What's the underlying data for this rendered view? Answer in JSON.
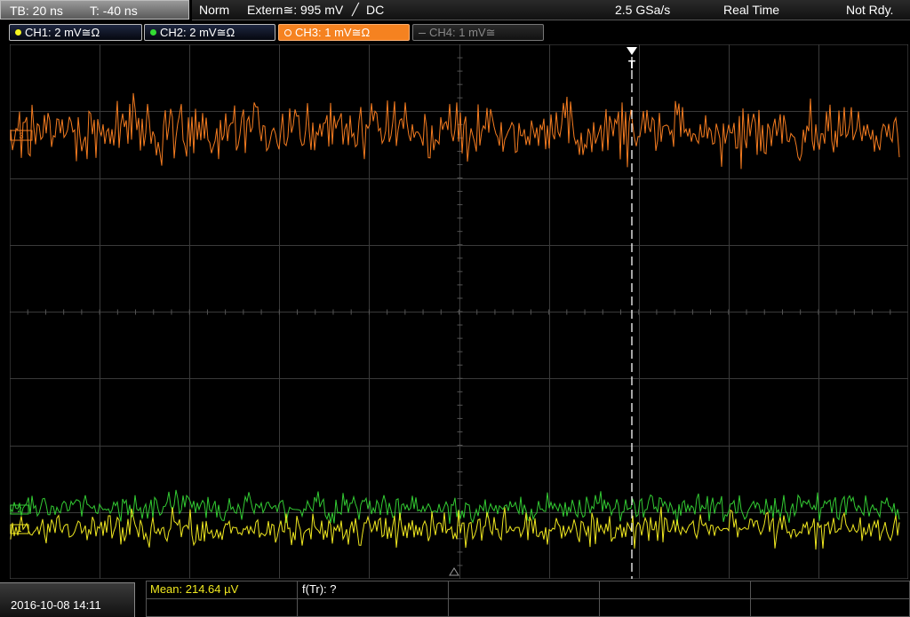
{
  "header": {
    "timebase": "TB: 20 ns",
    "trigger_offset": "T: -40 ns",
    "acq_mode": "Norm",
    "trigger_source": "Extern≅: 995 mV",
    "trigger_slope": "DC",
    "sample_rate": "2.5 GSa/s",
    "realtime": "Real Time",
    "status": "Not Rdy."
  },
  "channels": [
    {
      "label": "CH1: 2 mV≅Ω",
      "color": "#f5f520",
      "state": "on"
    },
    {
      "label": "CH2: 2 mV≅Ω",
      "color": "#33dd33",
      "state": "on"
    },
    {
      "label": "CH3: 1 mV≅Ω",
      "color": "#f58220",
      "state": "active"
    },
    {
      "label": "CH4: 1 mV≅",
      "color": "#888888",
      "state": "off"
    }
  ],
  "colors": {
    "ch1": "#f0e820",
    "ch2": "#33cc33",
    "ch3": "#f57c20",
    "grid": "#3a3a3a",
    "trigger_marker": "#ffffff"
  },
  "markers": {
    "ch3": "3",
    "ch2": "2",
    "ch1": "1",
    "trigger": "T"
  },
  "measurement": {
    "mean": "Mean: 214.64 µV",
    "ftr": "f(Tr): ?"
  },
  "datetime": "2016-10-08 14:11"
}
